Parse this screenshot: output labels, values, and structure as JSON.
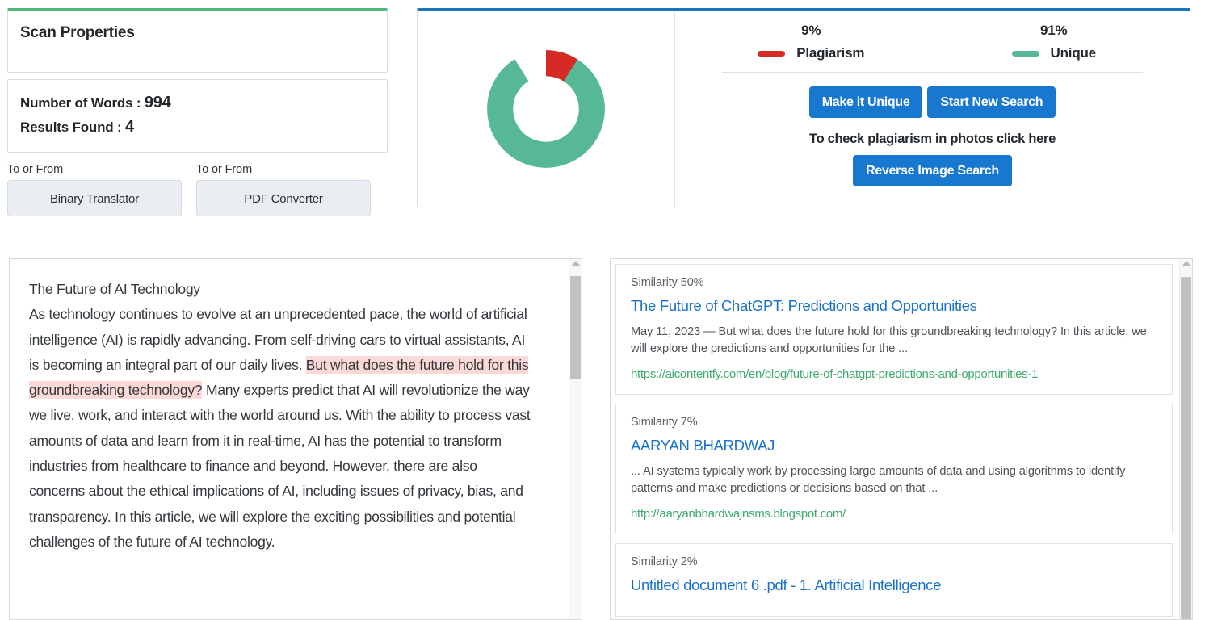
{
  "scan_properties": {
    "title": "Scan Properties",
    "words_label": "Number of Words :",
    "words_value": "994",
    "results_label": "Results Found :",
    "results_value": "4"
  },
  "tools": [
    {
      "label": "To or From",
      "button": "Binary Translator",
      "icon": "binary-translator-icon"
    },
    {
      "label": "To or From",
      "button": "PDF Converter",
      "icon": "pdf-converter-icon"
    }
  ],
  "summary": {
    "accent_color": "#1c75bc",
    "buttons": {
      "make_unique": "Make it Unique",
      "start_new_search": "Start New Search",
      "reverse_image_search": "Reverse Image Search"
    },
    "photo_note": "To check plagiarism in photos click here"
  },
  "chart_data": {
    "type": "pie",
    "variant": "donut",
    "title": "",
    "categories": [
      "Plagiarism",
      "Unique"
    ],
    "values": [
      9,
      91
    ],
    "value_labels": [
      "9%",
      "91%"
    ],
    "colors": [
      "#d52b26",
      "#56b894"
    ],
    "legend_position": "right",
    "start_angle_deg": 0,
    "direction": "clockwise",
    "inner_radius_ratio": 0.7
  },
  "document": {
    "title": "The Future of AI Technology",
    "body_before": "As technology continues to evolve at an unprecedented pace, the world of artificial intelligence (AI) is rapidly advancing. From self-driving cars to virtual assistants, AI is becoming an integral part of our daily lives. ",
    "highlight": "But what does the future hold for this groundbreaking technology?",
    "body_after": " Many experts predict that AI will revolutionize the way we live, work, and interact with the world around us. With the ability to process vast amounts of data and learn from it in real-time, AI has the potential to transform industries from healthcare to finance and beyond. However, there are also concerns about the ethical implications of AI, including issues of privacy, bias, and transparency. In this article, we will explore the exciting possibilities and potential challenges of the future of AI technology.",
    "highlight_color": "#fbd9d6"
  },
  "results": [
    {
      "similarity": "Similarity 50%",
      "title": "The Future of ChatGPT: Predictions and Opportunities",
      "snippet": "May 11, 2023 — But what does the future hold for this groundbreaking technology? In this article, we will explore the predictions and opportunities for the ...",
      "url": "https://aicontentfy.com/en/blog/future-of-chatgpt-predictions-and-opportunities-1"
    },
    {
      "similarity": "Similarity 7%",
      "title": "AARYAN BHARDWAJ",
      "snippet": "... AI systems typically work by processing large amounts of data and using algorithms to identify patterns and make predictions or decisions based on that ...",
      "url": "http://aaryanbhardwajnsms.blogspot.com/"
    },
    {
      "similarity": "Similarity 2%",
      "title": "Untitled document 6 .pdf - 1. Artificial Intelligence",
      "snippet": "",
      "url": ""
    }
  ]
}
